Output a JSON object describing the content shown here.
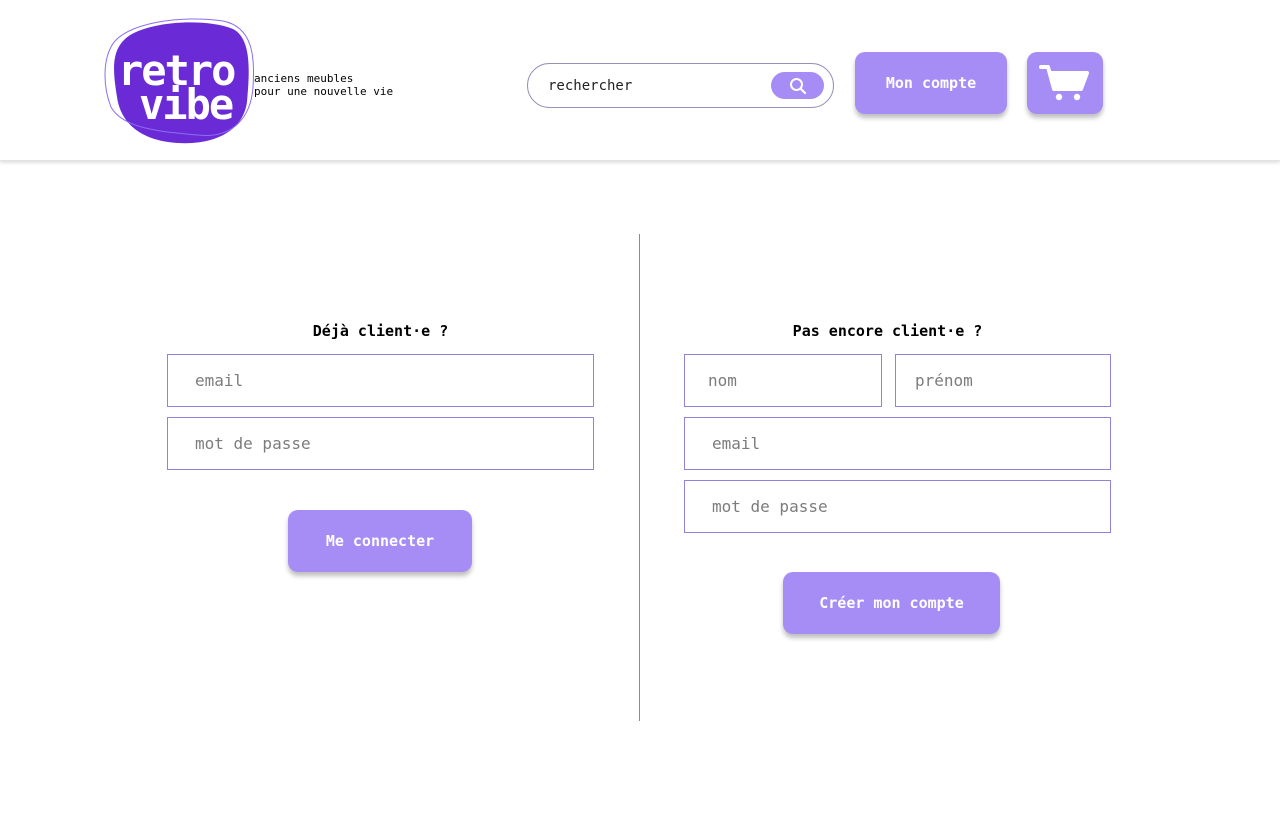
{
  "brand": {
    "logo_word1": "retro",
    "logo_word2": "vibe",
    "tagline_line1": "anciens meubles",
    "tagline_line2": "pour une nouvelle vie",
    "color": "#6a2bd6"
  },
  "header": {
    "search_placeholder": "rechercher",
    "search_icon": "search-icon",
    "account_label": "Mon compte",
    "cart_icon": "cart-icon"
  },
  "login": {
    "title": "Déjà client·e ?",
    "email_placeholder": "email",
    "password_placeholder": "mot de passe",
    "submit_label": "Me connecter"
  },
  "signup": {
    "title": "Pas encore client·e ?",
    "lastname_placeholder": "nom",
    "firstname_placeholder": "prénom",
    "email_placeholder": "email",
    "password_placeholder": "mot de passe",
    "submit_label": "Créer mon compte"
  },
  "colors": {
    "accent": "#a68cf5",
    "border": "#8f84dc"
  }
}
